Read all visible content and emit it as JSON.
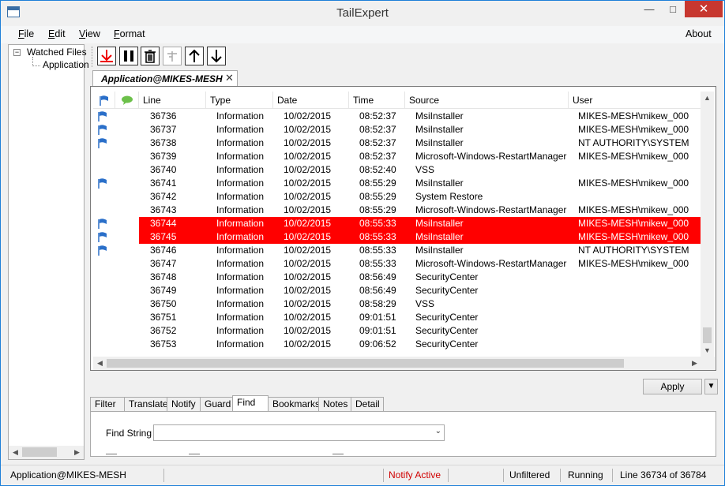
{
  "window": {
    "title": "TailExpert"
  },
  "menu": {
    "file": {
      "key": "F",
      "rest": "ile"
    },
    "edit": {
      "key": "E",
      "rest": "dit"
    },
    "view": {
      "key": "V",
      "rest": "iew"
    },
    "format": {
      "key": "F",
      "rest": "ormat"
    },
    "about": "About"
  },
  "tree": {
    "root": "Watched Files",
    "child": "Application"
  },
  "toolbar": {
    "icons": [
      "tail-to-end-icon",
      "pause-icon",
      "trash-icon",
      "clear-filter-icon",
      "arrow-up-icon",
      "arrow-down-icon"
    ]
  },
  "document_tab": {
    "label": "Application@MIKES-MESH",
    "close": "✕"
  },
  "grid": {
    "columns": [
      "",
      "",
      "Line",
      "Type",
      "Date",
      "Time",
      "Source",
      "User"
    ],
    "rows": [
      {
        "flag": true,
        "highlight": false,
        "line": "36736",
        "type": "Information",
        "date": "10/02/2015",
        "time": "08:52:37",
        "source": "MsiInstaller",
        "user": "MIKES-MESH\\mikew_000"
      },
      {
        "flag": true,
        "highlight": false,
        "line": "36737",
        "type": "Information",
        "date": "10/02/2015",
        "time": "08:52:37",
        "source": "MsiInstaller",
        "user": "MIKES-MESH\\mikew_000"
      },
      {
        "flag": true,
        "highlight": false,
        "line": "36738",
        "type": "Information",
        "date": "10/02/2015",
        "time": "08:52:37",
        "source": "MsiInstaller",
        "user": "NT AUTHORITY\\SYSTEM"
      },
      {
        "flag": false,
        "highlight": false,
        "line": "36739",
        "type": "Information",
        "date": "10/02/2015",
        "time": "08:52:37",
        "source": "Microsoft-Windows-RestartManager",
        "user": "MIKES-MESH\\mikew_000"
      },
      {
        "flag": false,
        "highlight": false,
        "line": "36740",
        "type": "Information",
        "date": "10/02/2015",
        "time": "08:52:40",
        "source": "VSS",
        "user": ""
      },
      {
        "flag": true,
        "highlight": false,
        "line": "36741",
        "type": "Information",
        "date": "10/02/2015",
        "time": "08:55:29",
        "source": "MsiInstaller",
        "user": "MIKES-MESH\\mikew_000"
      },
      {
        "flag": false,
        "highlight": false,
        "line": "36742",
        "type": "Information",
        "date": "10/02/2015",
        "time": "08:55:29",
        "source": "System Restore",
        "user": ""
      },
      {
        "flag": false,
        "highlight": false,
        "line": "36743",
        "type": "Information",
        "date": "10/02/2015",
        "time": "08:55:29",
        "source": "Microsoft-Windows-RestartManager",
        "user": "MIKES-MESH\\mikew_000"
      },
      {
        "flag": true,
        "highlight": true,
        "line": "36744",
        "type": "Information",
        "date": "10/02/2015",
        "time": "08:55:33",
        "source": "MsiInstaller",
        "user": "MIKES-MESH\\mikew_000"
      },
      {
        "flag": true,
        "highlight": true,
        "line": "36745",
        "type": "Information",
        "date": "10/02/2015",
        "time": "08:55:33",
        "source": "MsiInstaller",
        "user": "MIKES-MESH\\mikew_000"
      },
      {
        "flag": true,
        "highlight": false,
        "line": "36746",
        "type": "Information",
        "date": "10/02/2015",
        "time": "08:55:33",
        "source": "MsiInstaller",
        "user": "NT AUTHORITY\\SYSTEM"
      },
      {
        "flag": false,
        "highlight": false,
        "line": "36747",
        "type": "Information",
        "date": "10/02/2015",
        "time": "08:55:33",
        "source": "Microsoft-Windows-RestartManager",
        "user": "MIKES-MESH\\mikew_000"
      },
      {
        "flag": false,
        "highlight": false,
        "line": "36748",
        "type": "Information",
        "date": "10/02/2015",
        "time": "08:56:49",
        "source": "SecurityCenter",
        "user": ""
      },
      {
        "flag": false,
        "highlight": false,
        "line": "36749",
        "type": "Information",
        "date": "10/02/2015",
        "time": "08:56:49",
        "source": "SecurityCenter",
        "user": ""
      },
      {
        "flag": false,
        "highlight": false,
        "line": "36750",
        "type": "Information",
        "date": "10/02/2015",
        "time": "08:58:29",
        "source": "VSS",
        "user": ""
      },
      {
        "flag": false,
        "highlight": false,
        "line": "36751",
        "type": "Information",
        "date": "10/02/2015",
        "time": "09:01:51",
        "source": "SecurityCenter",
        "user": ""
      },
      {
        "flag": false,
        "highlight": false,
        "line": "36752",
        "type": "Information",
        "date": "10/02/2015",
        "time": "09:01:51",
        "source": "SecurityCenter",
        "user": ""
      },
      {
        "flag": false,
        "highlight": false,
        "line": "36753",
        "type": "Information",
        "date": "10/02/2015",
        "time": "09:06:52",
        "source": "SecurityCenter",
        "user": ""
      }
    ]
  },
  "apply": {
    "label": "Apply"
  },
  "tabs": [
    "Filter",
    "Translate",
    "Notify",
    "Guard",
    "Find",
    "Bookmarks",
    "Notes",
    "Detail"
  ],
  "active_tab": "Find",
  "find": {
    "label": "Find String",
    "value": ""
  },
  "status": {
    "file": "Application@MIKES-MESH",
    "notify": "Notify Active",
    "filter": "Unfiltered",
    "state": "Running",
    "position": "Line 36734 of 36784"
  },
  "colors": {
    "highlight": "#ff0000",
    "notify": "#d00000",
    "flag": "#2a6fc9",
    "comment": "#6cc04a"
  }
}
